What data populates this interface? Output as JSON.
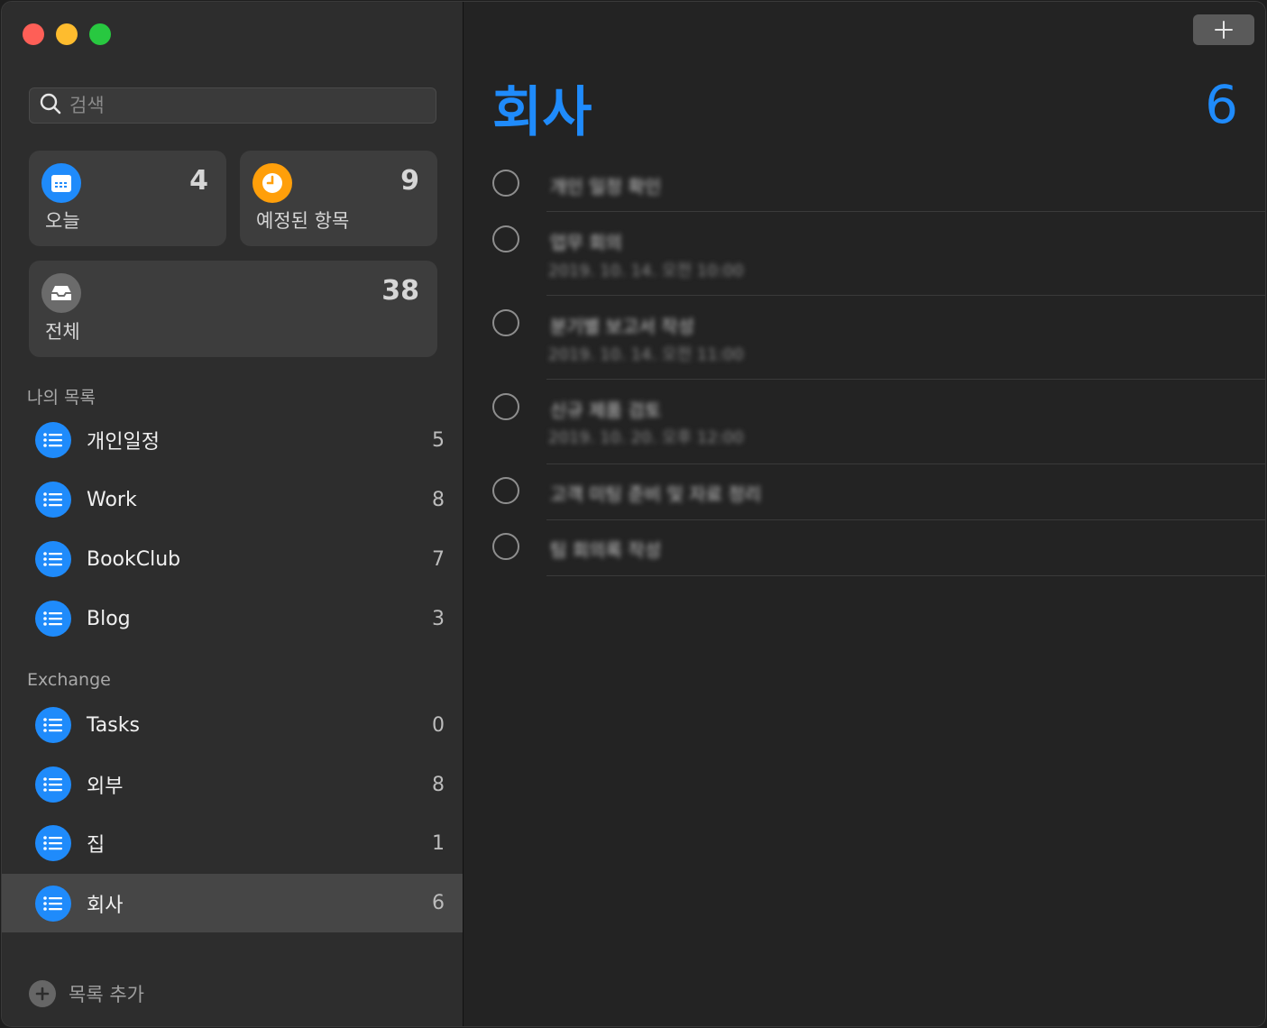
{
  "search": {
    "placeholder": "검색"
  },
  "smart_lists": [
    {
      "label": "오늘",
      "count": "4",
      "icon": "calendar-icon",
      "color": "#1f8bfb"
    },
    {
      "label": "예정된 항목",
      "count": "9",
      "icon": "clock-icon",
      "color": "#ff9f0a"
    },
    {
      "label": "전체",
      "count": "38",
      "icon": "tray-icon",
      "color": "#6b6b6b"
    }
  ],
  "sections": {
    "my_lists": "나의 목록",
    "exchange": "Exchange"
  },
  "my_lists": [
    {
      "name": "개인일정",
      "count": "5"
    },
    {
      "name": "Work",
      "count": "8"
    },
    {
      "name": "BookClub",
      "count": "7"
    },
    {
      "name": "Blog",
      "count": "3"
    }
  ],
  "exchange_lists": [
    {
      "name": "Tasks",
      "count": "0"
    },
    {
      "name": "외부",
      "count": "8"
    },
    {
      "name": "집",
      "count": "1"
    },
    {
      "name": "회사",
      "count": "6"
    }
  ],
  "add_list_label": "목록 추가",
  "main": {
    "title": "회사",
    "count": "6",
    "tasks": [
      {
        "title": "개인 일정 확인",
        "subtitle": ""
      },
      {
        "title": "업무 회의",
        "subtitle": "2019. 10. 14. 오전 10:00"
      },
      {
        "title": "분기별 보고서 작성",
        "subtitle": "2019. 10. 14. 오전 11:00"
      },
      {
        "title": "신규 제품 검토",
        "subtitle": "2019. 10. 20. 오후 12:00"
      },
      {
        "title": "고객 미팅 준비 및 자료 정리",
        "subtitle": ""
      },
      {
        "title": "팀 회의록 작성",
        "subtitle": ""
      }
    ]
  },
  "colors": {
    "accent": "#1f8bfb",
    "orange": "#ff9f0a"
  }
}
